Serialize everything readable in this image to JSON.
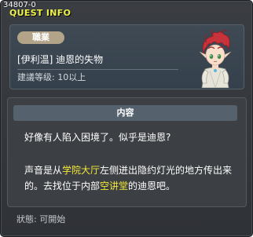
{
  "window": {
    "quest_id": "34807-0",
    "title": "QUEST INFO"
  },
  "quest": {
    "job_badge": "職業",
    "name": "[伊利温] 迪恩的失物",
    "level_requirement": "建議等级: 10以上"
  },
  "npc": {
    "description": "red-haired elf character portrait",
    "hair_color": "#c8323a",
    "eye_color": "#3b8a4a"
  },
  "content": {
    "header": "内容",
    "line1": "好像有人陷入困境了。似乎是迪恩?",
    "line2_a": "声音是从",
    "line2_hl1": "学院大厅",
    "line2_b": "左侧迸出隐约灯光的地方传出来的。去找位于内部",
    "line2_hl2": "空讲堂",
    "line2_c": "的迪恩吧。"
  },
  "status": "狀態: 可開始",
  "colors": {
    "title": "#eef24a",
    "highlight": "#f4ea3a",
    "window_bg": "#3a3d42",
    "panel_bg": "#3f4a55",
    "badge_bg": "#b3a489"
  }
}
